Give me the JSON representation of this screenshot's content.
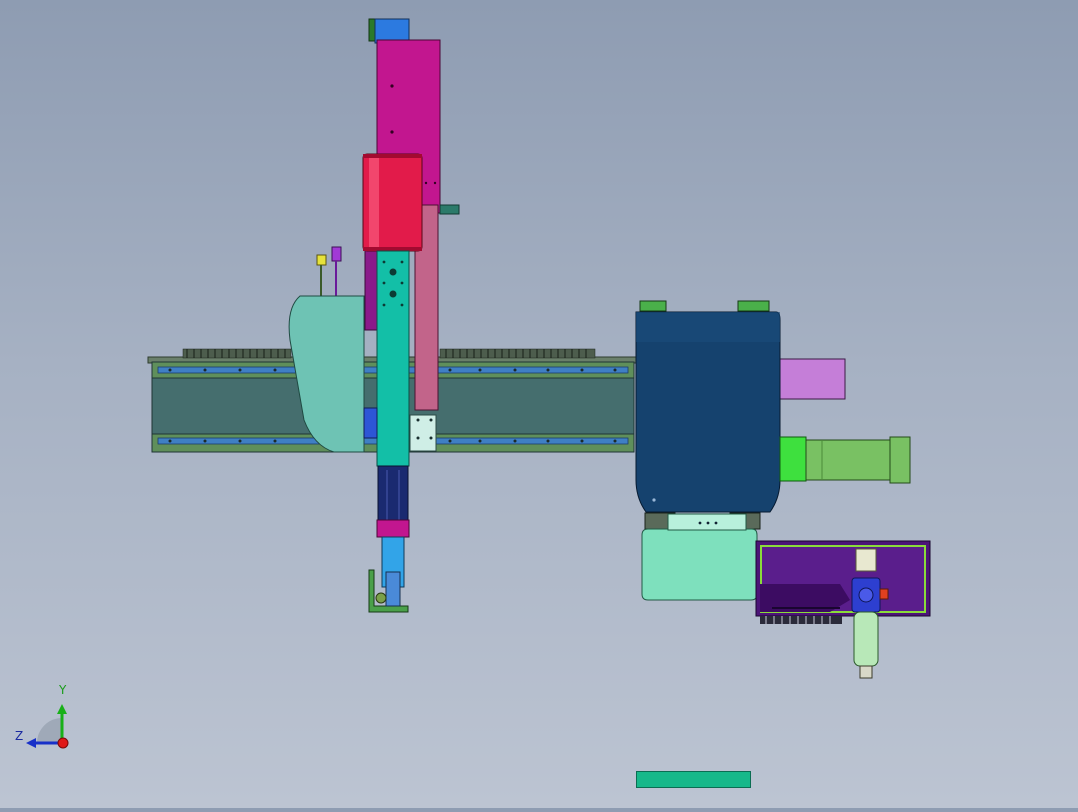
{
  "viewport": {
    "background_top": "#8e9cb2",
    "background_bottom": "#bcc4d2"
  },
  "model": {
    "parts": {
      "gantry_beam": "#456e6e",
      "beam_rails": "#3f7fc4",
      "vertical_column": "#c2168f",
      "red_cylinder": "#e21b4a",
      "teal_column": "#13bfa7",
      "carriage_cover": "#6ec3b4",
      "motor_housing": "#15426e",
      "servo_motor": "#79c163",
      "purple_bracket": "#4c1478",
      "frl_filter": "#2d3fd0",
      "mint_plate": "#7ee0bd"
    }
  },
  "triad": {
    "y_label": "Y",
    "z_label": "Z",
    "x_axis_color": "#e01818",
    "y_axis_color": "#18b018",
    "z_axis_color": "#1830c8"
  },
  "status": {
    "indicator_color": "#17b88a"
  }
}
